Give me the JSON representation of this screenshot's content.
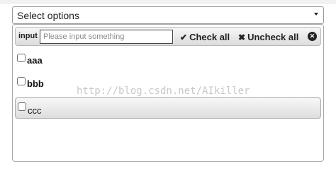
{
  "select": {
    "label": "Select options"
  },
  "filter": {
    "label": "input",
    "placeholder": "Please input something",
    "value": ""
  },
  "actions": {
    "check_all": "Check all",
    "uncheck_all": "Uncheck all",
    "check_glyph": "✔",
    "uncheck_glyph": "✖",
    "close_glyph": "✕"
  },
  "options": [
    {
      "label": "aaa",
      "checked": false
    },
    {
      "label": "bbb",
      "checked": false
    },
    {
      "label": "ccc",
      "checked": false
    }
  ],
  "watermark": "http://blog.csdn.net/AIkiller",
  "colors": {
    "border": "#9a9a9a",
    "toolbar_top": "#f7f7f7",
    "toolbar_bottom": "#dcdcdc",
    "text": "#222222",
    "watermark": "#c8c8c8"
  }
}
